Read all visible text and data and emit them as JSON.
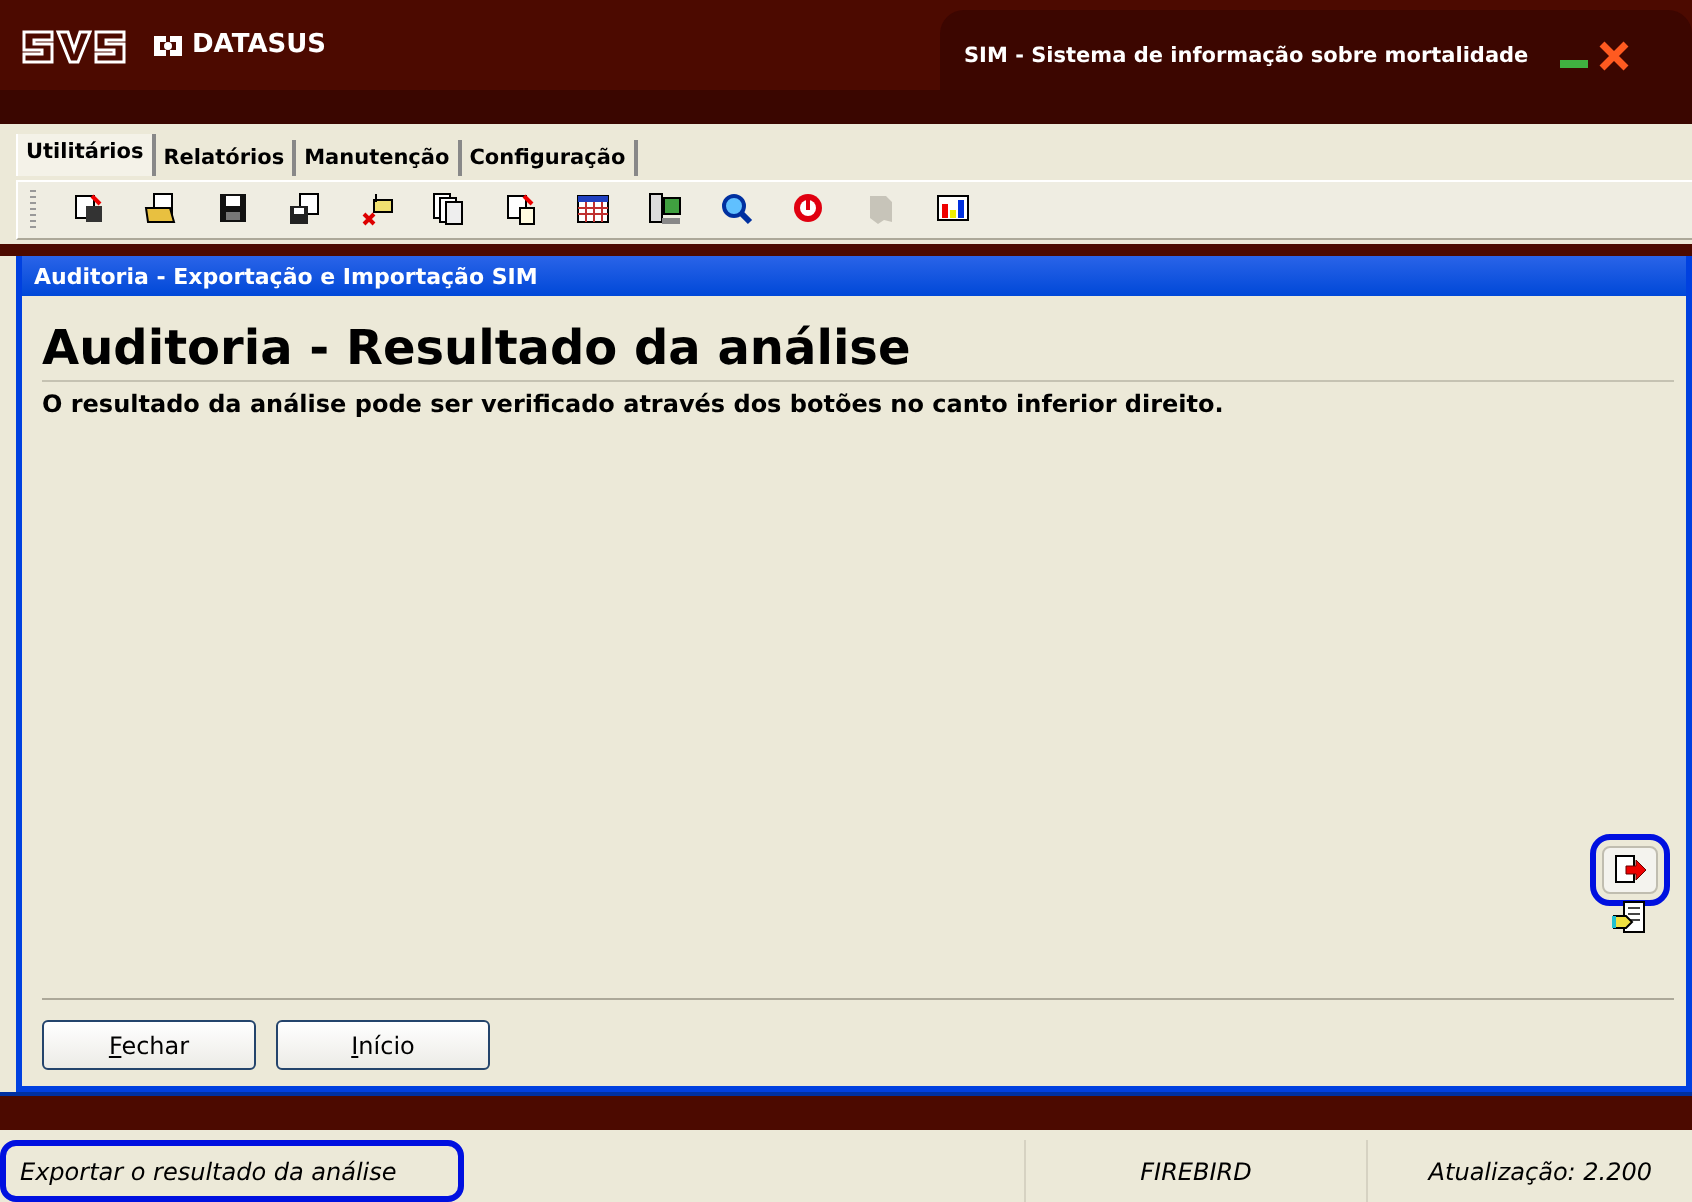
{
  "header": {
    "logo_text": "DATASUS",
    "title": "SIM - Sistema de informação sobre mortalidade"
  },
  "tabs": [
    {
      "label": "Utilitários",
      "selected": true
    },
    {
      "label": "Relatórios",
      "selected": false
    },
    {
      "label": "Manutenção",
      "selected": false
    },
    {
      "label": "Configuração",
      "selected": false
    }
  ],
  "toolbar": [
    {
      "disabled": false
    },
    {
      "disabled": false
    },
    {
      "disabled": false
    },
    {
      "disabled": false
    },
    {
      "disabled": false
    },
    {
      "disabled": false
    },
    {
      "disabled": false
    },
    {
      "disabled": false
    },
    {
      "disabled": false
    },
    {
      "disabled": false
    },
    {
      "disabled": false
    },
    {
      "disabled": true
    },
    {
      "disabled": false
    }
  ],
  "dialog": {
    "title": "Auditoria - Exportação e Importação SIM",
    "heading": "Auditoria - Resultado da análise",
    "message": "O resultado da análise pode ser verificado através dos botões no canto inferior direito.",
    "side_buttons": [
      {
        "highlighted": true
      },
      {
        "highlighted": false
      }
    ],
    "buttons": [
      {
        "label": "Fechar"
      },
      {
        "label": "Início"
      }
    ]
  },
  "status_bar": [
    {
      "text": "Exportar o resultado da análise",
      "highlighted": true
    },
    {
      "text": "FIREBIRD",
      "highlighted": false
    },
    {
      "text": "Atualização: 2.200",
      "highlighted": false
    }
  ]
}
